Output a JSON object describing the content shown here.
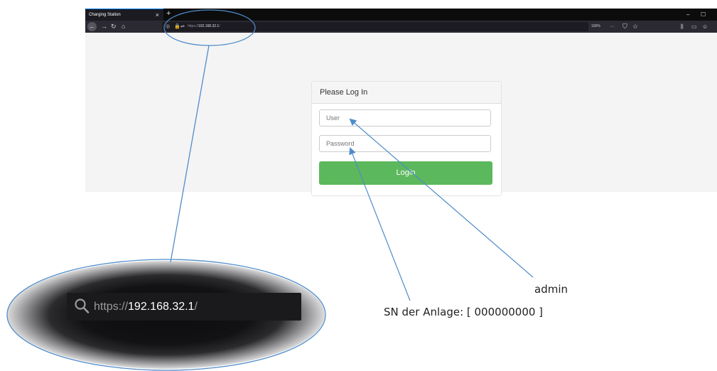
{
  "browser": {
    "tab_title": "Charging Station",
    "tab_close": "×",
    "new_tab": "+",
    "url_scheme": "https://",
    "url_host": "192.168.32.1",
    "url_suffix": "/",
    "zoom_level": "100%",
    "more": "···",
    "window_controls": [
      "–",
      "☐"
    ]
  },
  "login": {
    "title": "Please Log In",
    "user_placeholder": "User",
    "password_placeholder": "Password",
    "button_label": "Login"
  },
  "zoomed_url": {
    "scheme": "https://",
    "host": "192.168.32.1",
    "suffix": "/"
  },
  "annotations": {
    "user_hint": "admin",
    "password_hint": "SN der Anlage: [ 000000000  ]"
  },
  "colors": {
    "login_button": "#5cb85c",
    "annotation_line": "#4f8cc9",
    "tab_accent": "#0a84ff"
  }
}
